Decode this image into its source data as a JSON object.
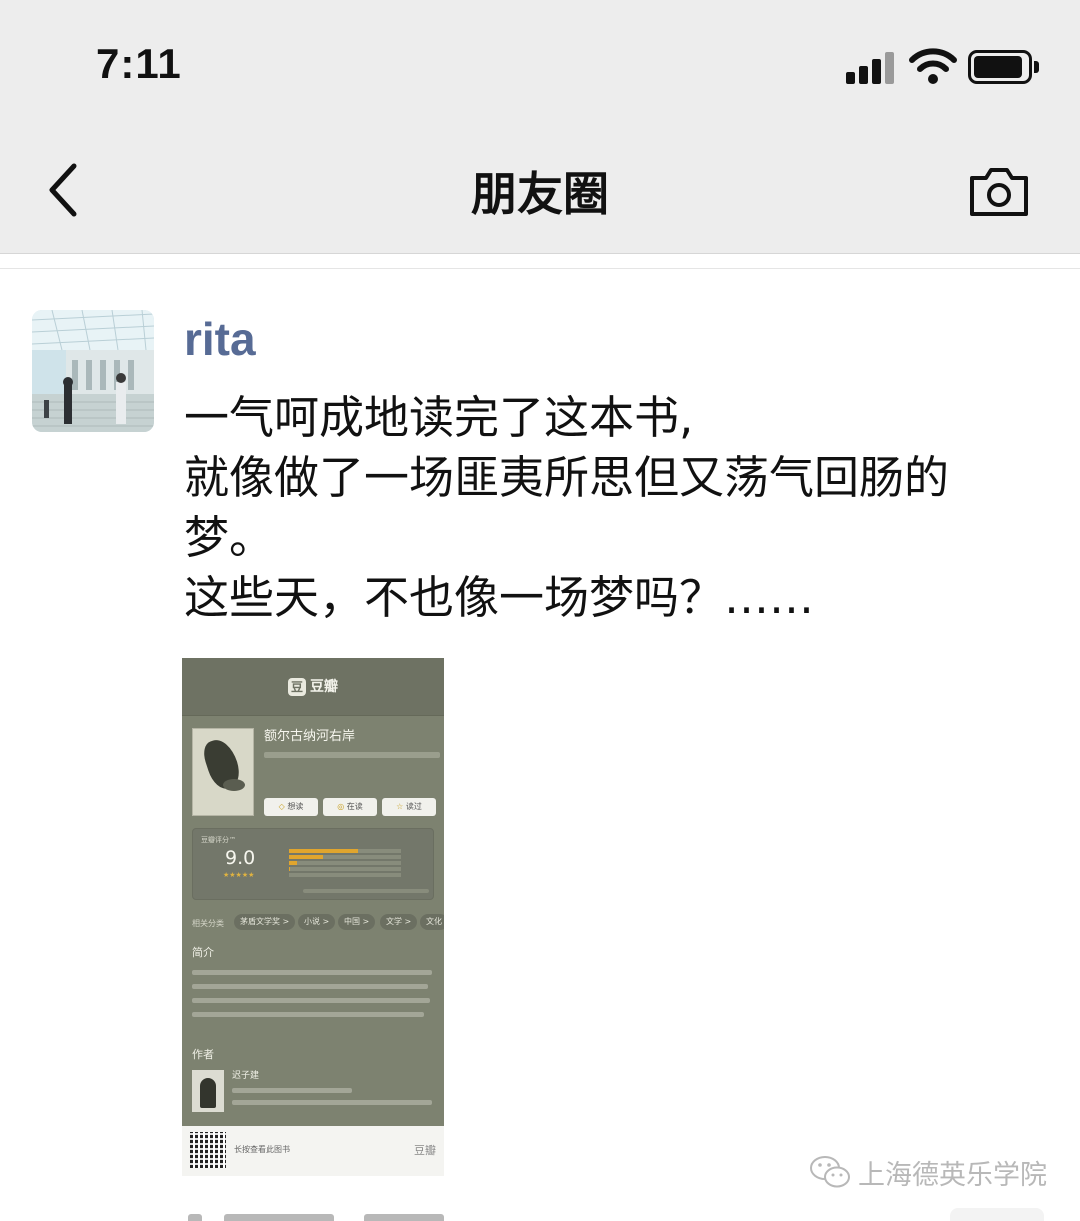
{
  "status_bar": {
    "time": "7:11"
  },
  "nav": {
    "title": "朋友圈",
    "back_icon": "chevron-left-icon",
    "camera_icon": "camera-icon"
  },
  "post": {
    "username": "rita",
    "lines": [
      "一气呵成地读完了这本书,",
      "就像做了一场匪夷所思但又荡气回肠的",
      "梦。",
      "这些天，不也像一场梦吗？……"
    ],
    "shared_image": {
      "brand": "豆瓣",
      "logo_char": "豆",
      "book_title": "额尔古纳河右岸",
      "buttons": [
        "想读",
        "在读",
        "读过"
      ],
      "rating_label": "豆瓣评分™",
      "rating_value": "9.0",
      "rating_stars": "★★★★★",
      "rating_distribution": [
        0.62,
        0.3,
        0.07,
        0.01,
        0.0
      ],
      "tags_label": "相关分类",
      "tags": [
        "茅盾文学奖 >",
        "小说 >",
        "中国 >",
        "文学 >",
        "文化"
      ],
      "intro_heading": "简介",
      "author_heading": "作者",
      "author_name": "迟子建",
      "footer_text": "长按查看此图书",
      "footer_brand": "豆瓣"
    }
  },
  "watermark": {
    "text": "上海德英乐学院"
  },
  "colors": {
    "bar_bg": "#ededed",
    "username": "#576b95",
    "douban_bg": "#7d8270"
  }
}
